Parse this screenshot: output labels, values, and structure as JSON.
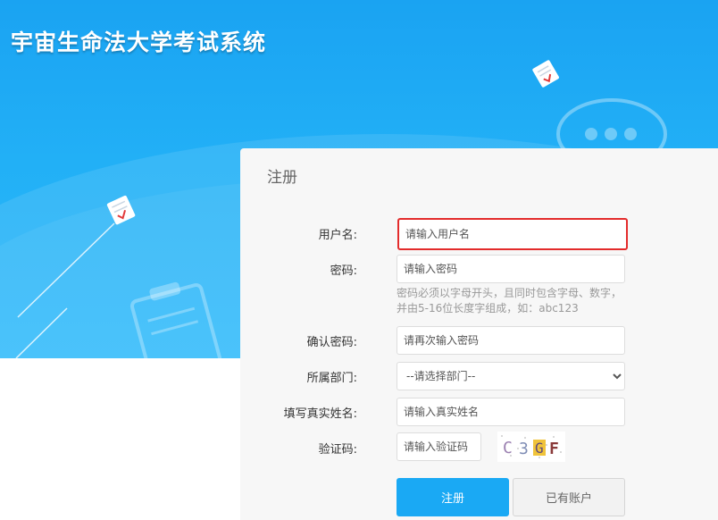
{
  "header": {
    "title": "宇宙生命法大学考试系统"
  },
  "form": {
    "title": "注册",
    "username": {
      "label": "用户名:",
      "placeholder": "请输入用户名"
    },
    "password": {
      "label": "密码:",
      "placeholder": "请输入密码",
      "hint_line1": "密码必须以字母开头，且同时包含字母、数字，",
      "hint_line2": "并由5-16位长度字组成，如：abc123"
    },
    "confirm": {
      "label": "确认密码:",
      "placeholder": "请再次输入密码"
    },
    "department": {
      "label": "所属部门:",
      "selected": "--请选择部门--"
    },
    "realname": {
      "label": "填写真实姓名:",
      "placeholder": "请输入真实姓名"
    },
    "captcha": {
      "label": "验证码:",
      "placeholder": "请输入验证码",
      "code": "C3GF"
    },
    "submit_label": "注册",
    "have_account_label": "已有账户"
  },
  "colors": {
    "primary": "#1aa9f4",
    "highlight": "#e32b2b",
    "hero": "#22b0f6"
  }
}
